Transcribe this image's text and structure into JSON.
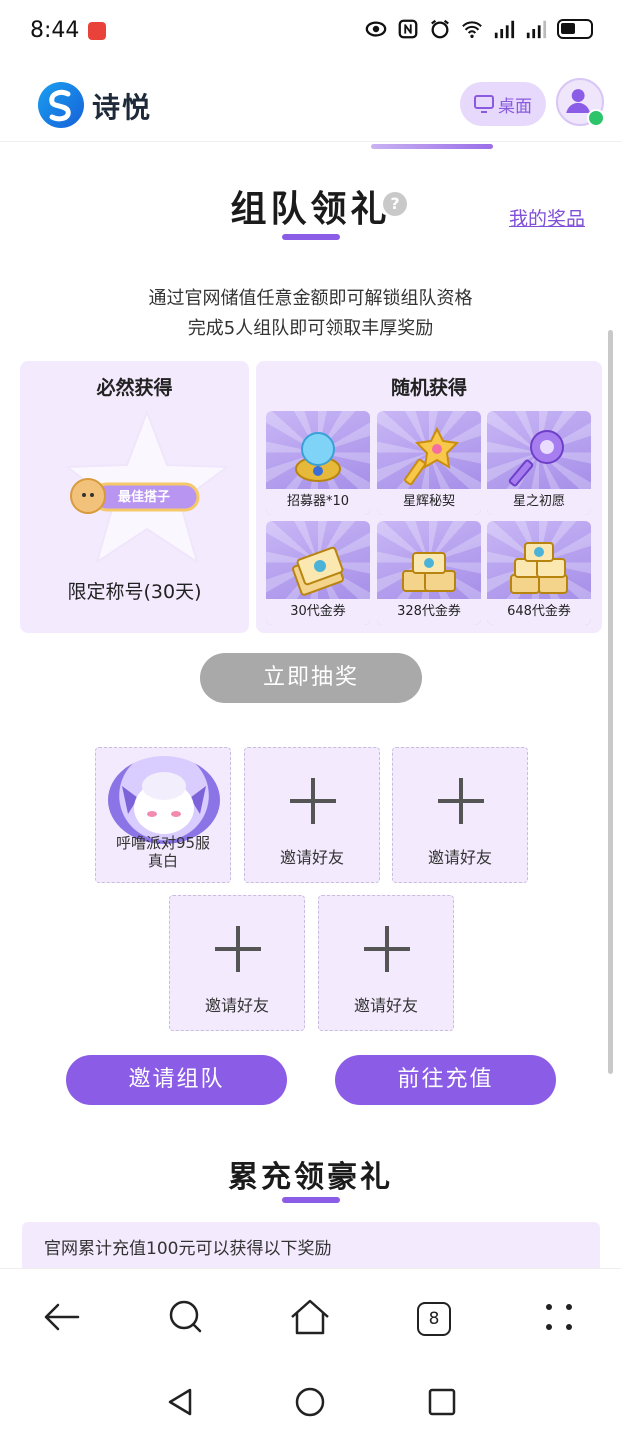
{
  "status": {
    "time": "8:44"
  },
  "header": {
    "brand": "诗悦",
    "desktop_label": "桌面"
  },
  "team": {
    "title": "组队领礼",
    "help": "?",
    "my_prizes": "我的奖品",
    "desc_line1": "通过官网储值任意金额即可解锁组队资格",
    "desc_line2": "完成5人组队即可领取丰厚奖励",
    "guaranteed": {
      "title": "必然获得",
      "badge_text": "最佳搭子",
      "reward": "限定称号(30天)"
    },
    "random": {
      "title": "随机获得",
      "items": [
        "招募器*10",
        "星辉秘契",
        "星之初愿",
        "30代金券",
        "328代金券",
        "648代金券"
      ]
    },
    "draw_button": "立即抽奖",
    "member": {
      "name_line1": "呼噜派对95服",
      "name_line2": "真白"
    },
    "invite_label": "邀请好友",
    "invite_team_button": "邀请组队",
    "recharge_button": "前往充值"
  },
  "cumulative": {
    "title": "累充领豪礼",
    "info": "官网累计充值100元可以获得以下奖励"
  },
  "browser": {
    "tab_count": "8"
  }
}
